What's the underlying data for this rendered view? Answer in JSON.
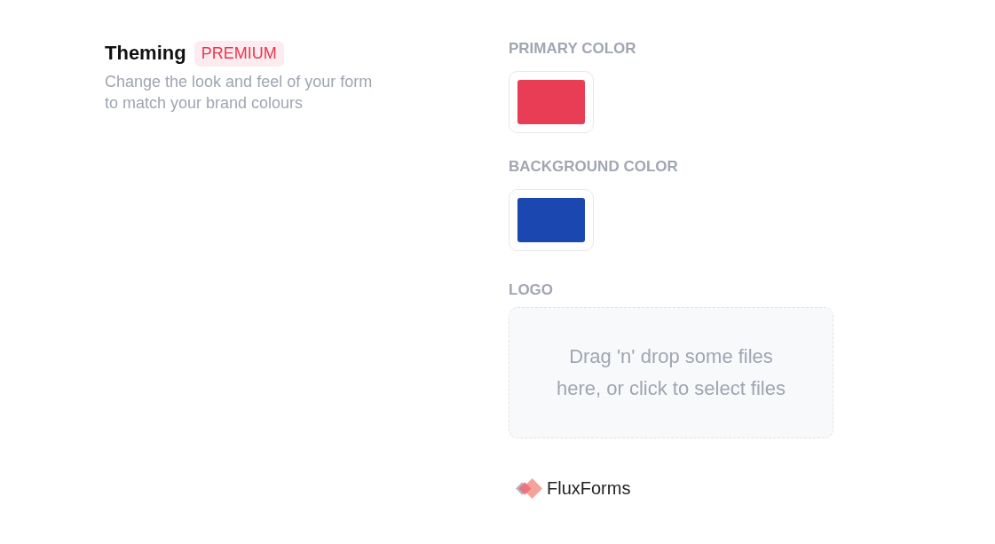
{
  "section": {
    "title": "Theming",
    "badge": "PREMIUM",
    "description": "Change the look and feel of your form to match your brand colours"
  },
  "fields": [
    {
      "kind": "color",
      "label": "PRIMARY COLOR",
      "color": "#e93d56"
    },
    {
      "kind": "color",
      "label": "BACKGROUND COLOR",
      "color": "#1a47b0"
    },
    {
      "kind": "dropzone",
      "label": "LOGO",
      "placeholder": "Drag 'n' drop some files here, or click to select files"
    }
  ],
  "brand": {
    "name": "FluxForms"
  }
}
